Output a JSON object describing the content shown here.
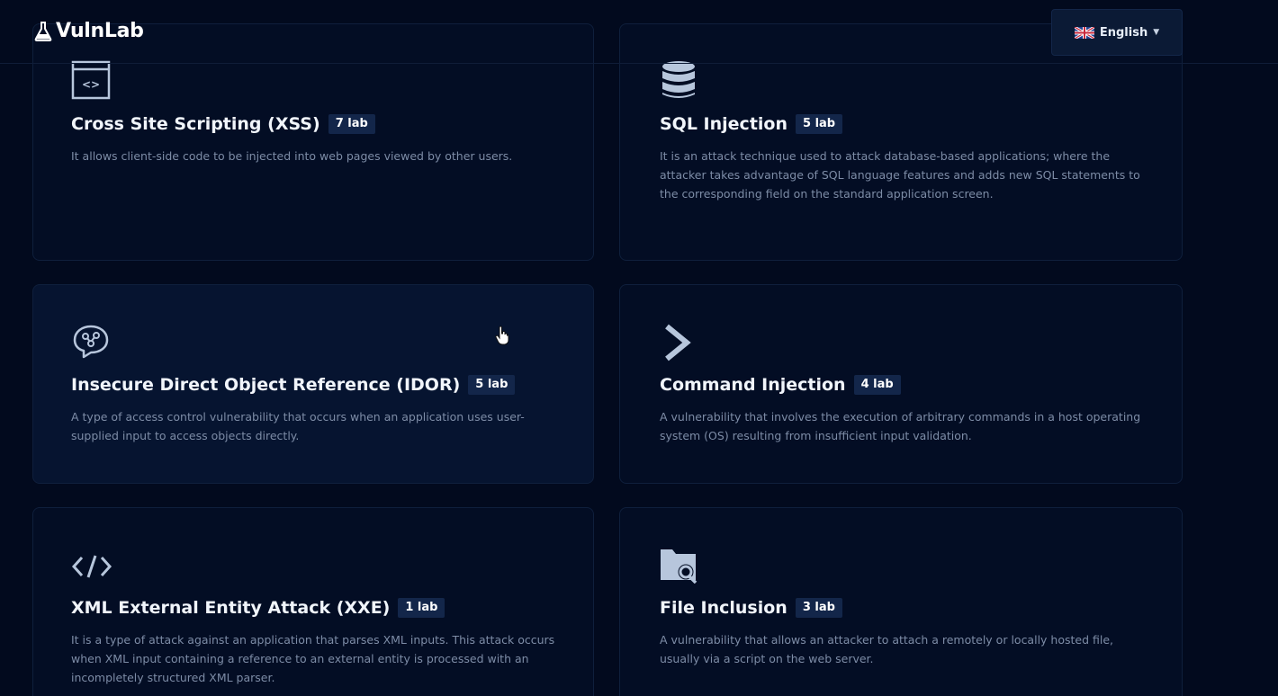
{
  "header": {
    "brand": "VulnLab",
    "language": "English"
  },
  "cards": [
    {
      "title": "Cross Site Scripting (XSS)",
      "badge": "7 lab",
      "desc": "It allows client-side code to be injected into web pages viewed by other users.",
      "icon": "browser-code-icon"
    },
    {
      "title": "SQL Injection",
      "badge": "5 lab",
      "desc": "It is an attack technique used to attack database-based applications; where the attacker takes advantage of SQL language features and adds new SQL statements to the corresponding field on the standard application screen.",
      "icon": "database-icon"
    },
    {
      "title": "Insecure Direct Object Reference (IDOR)",
      "badge": "5 lab",
      "desc": "A type of access control vulnerability that occurs when an application uses user-supplied input to access objects directly.",
      "icon": "brain-icon"
    },
    {
      "title": "Command Injection",
      "badge": "4 lab",
      "desc": "A vulnerability that involves the execution of arbitrary commands in a host operating system (OS) resulting from insufficient input validation.",
      "icon": "chevron-right-icon"
    },
    {
      "title": "XML External Entity Attack (XXE)",
      "badge": "1 lab",
      "desc": "It is a type of attack against an application that parses XML inputs. This attack occurs when XML input containing a reference to an external entity is processed with an incompletely structured XML parser.",
      "icon": "code-tag-icon"
    },
    {
      "title": "File Inclusion",
      "badge": "3 lab",
      "desc": "A vulnerability that allows an attacker to attach a remotely or locally hosted file, usually via a script on the web server.",
      "icon": "folder-search-icon"
    }
  ]
}
